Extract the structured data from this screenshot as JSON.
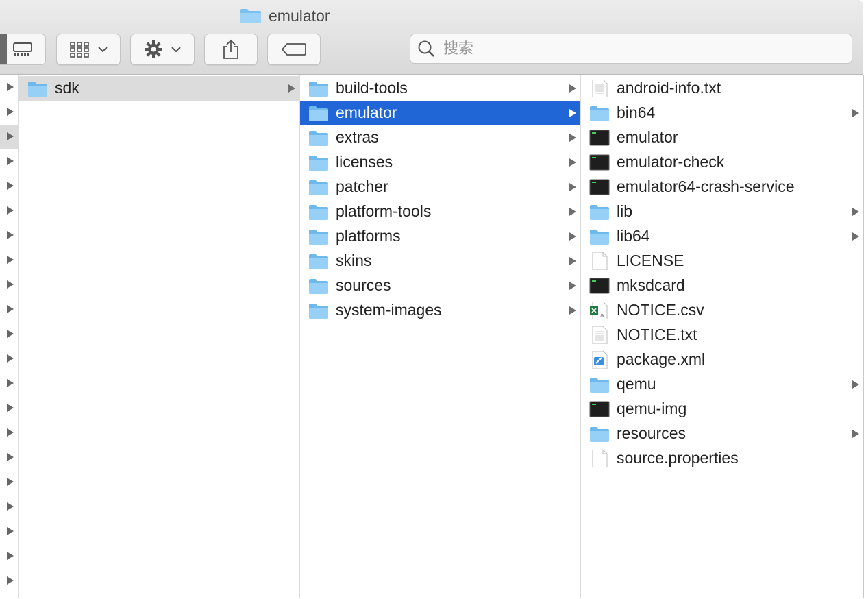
{
  "window": {
    "title": "emulator"
  },
  "toolbar": {
    "search_placeholder": "搜索"
  },
  "column_sdk": {
    "items": [
      {
        "label": "sdk",
        "type": "folder",
        "has_children": true,
        "selected": true
      }
    ]
  },
  "column_main": {
    "items": [
      {
        "label": "build-tools",
        "type": "folder",
        "has_children": true
      },
      {
        "label": "emulator",
        "type": "folder",
        "has_children": true,
        "selected": true
      },
      {
        "label": "extras",
        "type": "folder",
        "has_children": true
      },
      {
        "label": "licenses",
        "type": "folder",
        "has_children": true
      },
      {
        "label": "patcher",
        "type": "folder",
        "has_children": true
      },
      {
        "label": "platform-tools",
        "type": "folder",
        "has_children": true
      },
      {
        "label": "platforms",
        "type": "folder",
        "has_children": true
      },
      {
        "label": "skins",
        "type": "folder",
        "has_children": true
      },
      {
        "label": "sources",
        "type": "folder",
        "has_children": true
      },
      {
        "label": "system-images",
        "type": "folder",
        "has_children": true
      }
    ]
  },
  "column_emulator": {
    "items": [
      {
        "label": "android-info.txt",
        "type": "text",
        "has_children": false
      },
      {
        "label": "bin64",
        "type": "folder",
        "has_children": true
      },
      {
        "label": "emulator",
        "type": "exec",
        "has_children": false
      },
      {
        "label": "emulator-check",
        "type": "exec",
        "has_children": false
      },
      {
        "label": "emulator64-crash-service",
        "type": "exec",
        "has_children": false
      },
      {
        "label": "lib",
        "type": "folder",
        "has_children": true
      },
      {
        "label": "lib64",
        "type": "folder",
        "has_children": true
      },
      {
        "label": "LICENSE",
        "type": "blank",
        "has_children": false
      },
      {
        "label": "mksdcard",
        "type": "exec",
        "has_children": false
      },
      {
        "label": "NOTICE.csv",
        "type": "csv",
        "has_children": false
      },
      {
        "label": "NOTICE.txt",
        "type": "text",
        "has_children": false
      },
      {
        "label": "package.xml",
        "type": "xml",
        "has_children": false
      },
      {
        "label": "qemu",
        "type": "folder",
        "has_children": true
      },
      {
        "label": "qemu-img",
        "type": "exec",
        "has_children": false
      },
      {
        "label": "resources",
        "type": "folder",
        "has_children": true
      },
      {
        "label": "source.properties",
        "type": "blank",
        "has_children": false
      }
    ]
  },
  "left_edge_rows": 21,
  "colors": {
    "selection_blue": "#2166d6",
    "selection_grey": "#dcdcdc",
    "folder_blue": "#8dcbf4"
  }
}
